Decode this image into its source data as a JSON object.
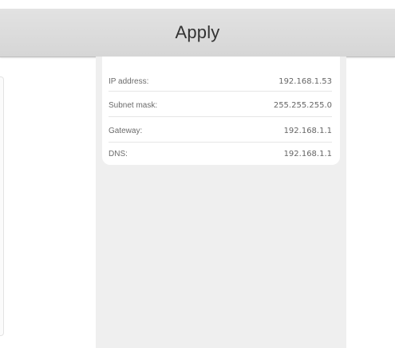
{
  "apply_button": {
    "label": "Apply"
  },
  "network_info": {
    "rows": [
      {
        "label": "IP address:",
        "value": "192.168.1.53"
      },
      {
        "label": "Subnet mask:",
        "value": "255.255.255.0"
      },
      {
        "label": "Gateway:",
        "value": "192.168.1.1"
      },
      {
        "label": "DNS:",
        "value": "192.168.1.1"
      }
    ]
  }
}
